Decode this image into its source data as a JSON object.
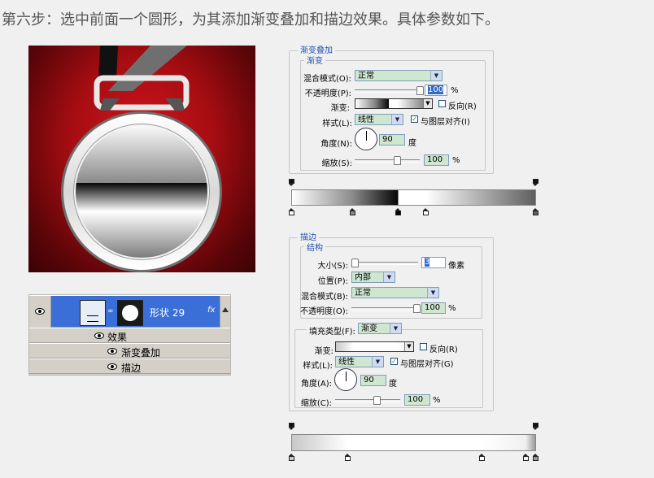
{
  "title": "第六步：选中前面一个圆形，为其添加渐变叠加和描边效果。具体参数如下。",
  "layers": {
    "layer_name": "形状 29",
    "fx": "fx",
    "effects_label": "效果",
    "effect1": "渐变叠加",
    "effect2": "描边"
  },
  "gradient_overlay": {
    "title": "渐变叠加",
    "section": "渐变",
    "blend_mode_label": "混合模式(O):",
    "blend_mode": "正常",
    "opacity_label": "不透明度(P):",
    "opacity": "100",
    "percent": "%",
    "gradient_label": "渐变:",
    "reverse_label": "反向(R)",
    "style_label": "样式(L):",
    "style": "线性",
    "align_label": "与图层对齐(I)",
    "angle_label": "角度(N):",
    "angle": "90",
    "degree": "度",
    "scale_label": "缩放(S):",
    "scale": "100",
    "gradient_stops": [
      {
        "color": "#ffffff",
        "location": 0
      },
      {
        "color": "#8a8a8a",
        "location": 0.25
      },
      {
        "color": "#050505",
        "location": 0.437
      },
      {
        "color": "#ffffff",
        "location": 0.437
      },
      {
        "color": "#ffffff",
        "location": 0.55
      },
      {
        "color": "#5f5f5f",
        "location": 1
      }
    ]
  },
  "stroke": {
    "title": "描边",
    "section": "结构",
    "size_label": "大小(S):",
    "size": "3",
    "px_unit": "像素",
    "position_label": "位置(P):",
    "position": "内部",
    "blend_mode_label": "混合模式(B):",
    "blend_mode": "正常",
    "opacity_label": "不透明度(O):",
    "opacity": "100",
    "percent": "%",
    "fill_type_label": "填充类型(F):",
    "fill_type": "渐变",
    "gradient_label": "渐变:",
    "reverse_label": "反向(R)",
    "style_label": "样式(L):",
    "style": "线性",
    "align_label": "与图层对齐(G)",
    "angle_label": "角度(A):",
    "angle": "90",
    "degree": "度",
    "scale_label": "缩放(C):",
    "scale": "100",
    "gradient_stops": [
      {
        "color": "#c8c8c8",
        "location": 0
      },
      {
        "color": "#ffffff",
        "location": 0.23
      },
      {
        "color": "#ffffff",
        "location": 0.78
      },
      {
        "color": "#f0f0f0",
        "location": 0.96
      },
      {
        "color": "#9a9a9a",
        "location": 1
      }
    ]
  }
}
